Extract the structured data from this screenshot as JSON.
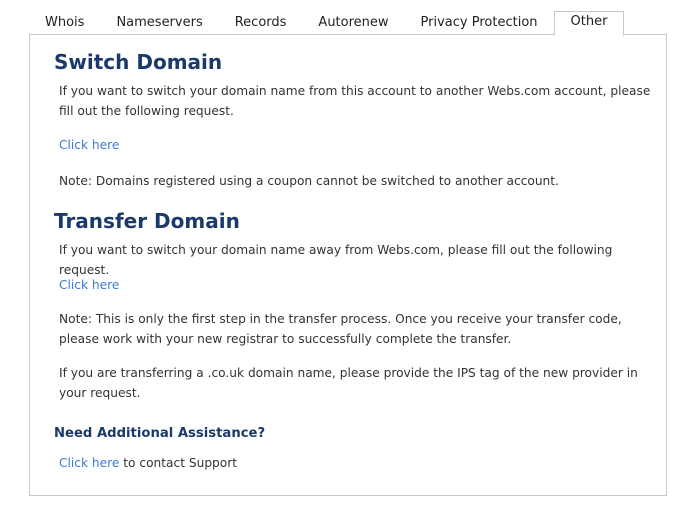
{
  "tabs": [
    {
      "label": "Whois",
      "active": false
    },
    {
      "label": "Nameservers",
      "active": false
    },
    {
      "label": "Records",
      "active": false
    },
    {
      "label": "Autorenew",
      "active": false
    },
    {
      "label": "Privacy Protection",
      "active": false
    },
    {
      "label": "Other",
      "active": true
    }
  ],
  "switch_domain": {
    "title": "Switch Domain",
    "description": "If you want to switch your domain name from this account to another Webs.com account, please fill out the following request.",
    "link": "Click here",
    "note": "Note: Domains registered using a coupon cannot be switched to another account."
  },
  "transfer_domain": {
    "title": "Transfer Domain",
    "description": "If you want to switch your domain name away from Webs.com, please fill out the following request.",
    "link": "Click here",
    "note": "Note: This is only the first step in the transfer process. Once you receive your transfer code, please work with your new registrar to successfully complete the transfer.",
    "couk_note": "If you are transferring a .co.uk domain name, please provide the IPS tag of the new provider in your request."
  },
  "assistance": {
    "title": "Need Additional Assistance?",
    "link": "Click here",
    "suffix": " to contact Support"
  },
  "colors": {
    "heading": "#1b3a6b",
    "link": "#3d7ccf",
    "body_text": "#333333",
    "border": "#c8c8c8"
  }
}
